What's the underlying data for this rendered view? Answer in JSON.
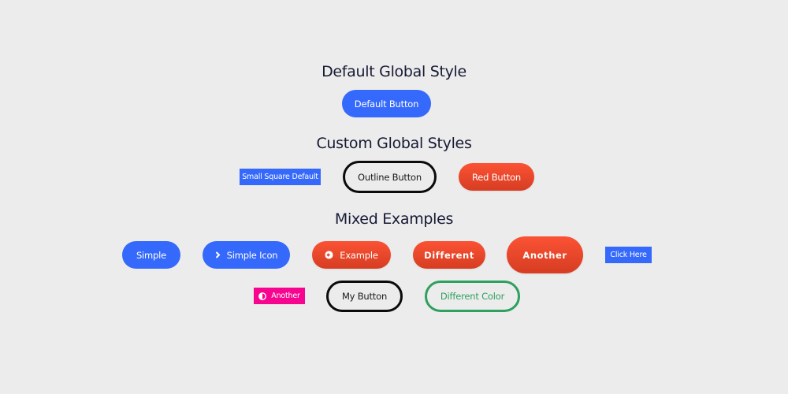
{
  "sections": {
    "default": {
      "title": "Default Global Style",
      "buttons": {
        "default": "Default Button"
      }
    },
    "custom": {
      "title": "Custom Global Styles",
      "buttons": {
        "small_square": "Small Square Default",
        "outline": "Outline Button",
        "red": "Red Button"
      }
    },
    "mixed": {
      "title": "Mixed Examples",
      "buttons": {
        "simple": "Simple",
        "simple_icon": "Simple Icon",
        "example": "Example",
        "different": "Different",
        "another_large": "Another",
        "click_here": "Click Here",
        "another_pink": "Another",
        "my_button": "My Button",
        "different_color": "Different Color"
      },
      "icons": {
        "simple_icon": "chevron-right-icon",
        "example": "arrow-left-circle-icon",
        "another_pink": "contrast-icon"
      }
    }
  },
  "colors": {
    "background": "#ececec",
    "heading": "#161a33",
    "blue": "#3569fb",
    "red_top": "#fb5234",
    "red_bottom": "#d63d22",
    "pink": "#f7058f",
    "green": "#2ea05f",
    "outline": "#0b0b0b"
  }
}
